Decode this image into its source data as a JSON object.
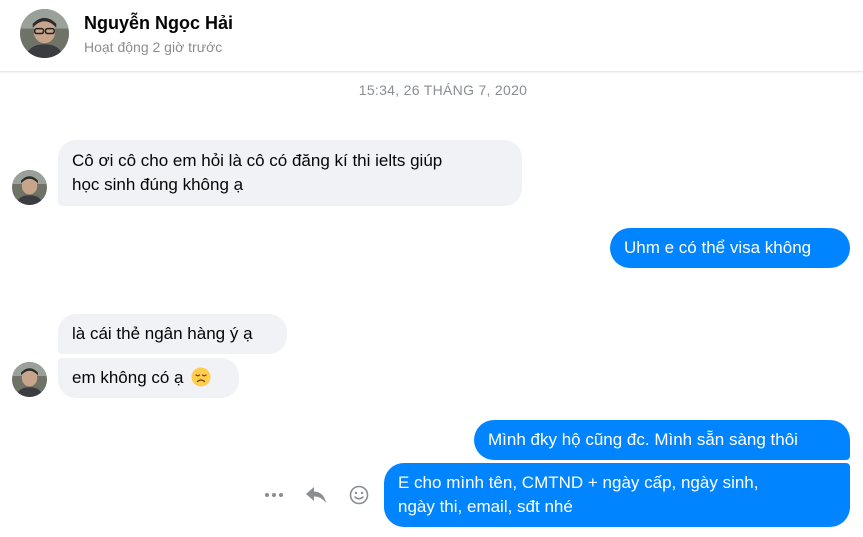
{
  "header": {
    "contact_name": "Nguyễn Ngọc Hải",
    "status": "Hoạt động 2 giờ trước"
  },
  "timestamp": "15:34, 26 THÁNG 7, 2020",
  "messages": [
    {
      "direction": "incoming",
      "lines": [
        "Cô ơi cô cho em hỏi là cô có đăng kí thi ielts giúp",
        "học sinh đúng không ạ"
      ]
    },
    {
      "direction": "outgoing",
      "lines": [
        "Uhm e có thể visa không"
      ]
    },
    {
      "direction": "incoming",
      "lines": [
        "là cái thẻ ngân hàng ý ạ"
      ]
    },
    {
      "direction": "incoming",
      "lines": [
        "em không có ạ"
      ],
      "emoji": "disappointed-face-emoji"
    },
    {
      "direction": "outgoing",
      "lines": [
        "Mình đky hộ cũng đc. Mình sẵn sàng thôi"
      ]
    },
    {
      "direction": "outgoing",
      "lines": [
        "E cho mình tên, CMTND + ngày cấp, ngày sinh,",
        "ngày thi, email, sđt nhé"
      ]
    }
  ],
  "message_actions": [
    "more-icon",
    "reply-icon",
    "react-emoji-icon"
  ],
  "colors": {
    "outgoing_bubble": "#0084ff",
    "incoming_bubble": "#f0f2f5",
    "secondary_text": "#8a8d91"
  }
}
